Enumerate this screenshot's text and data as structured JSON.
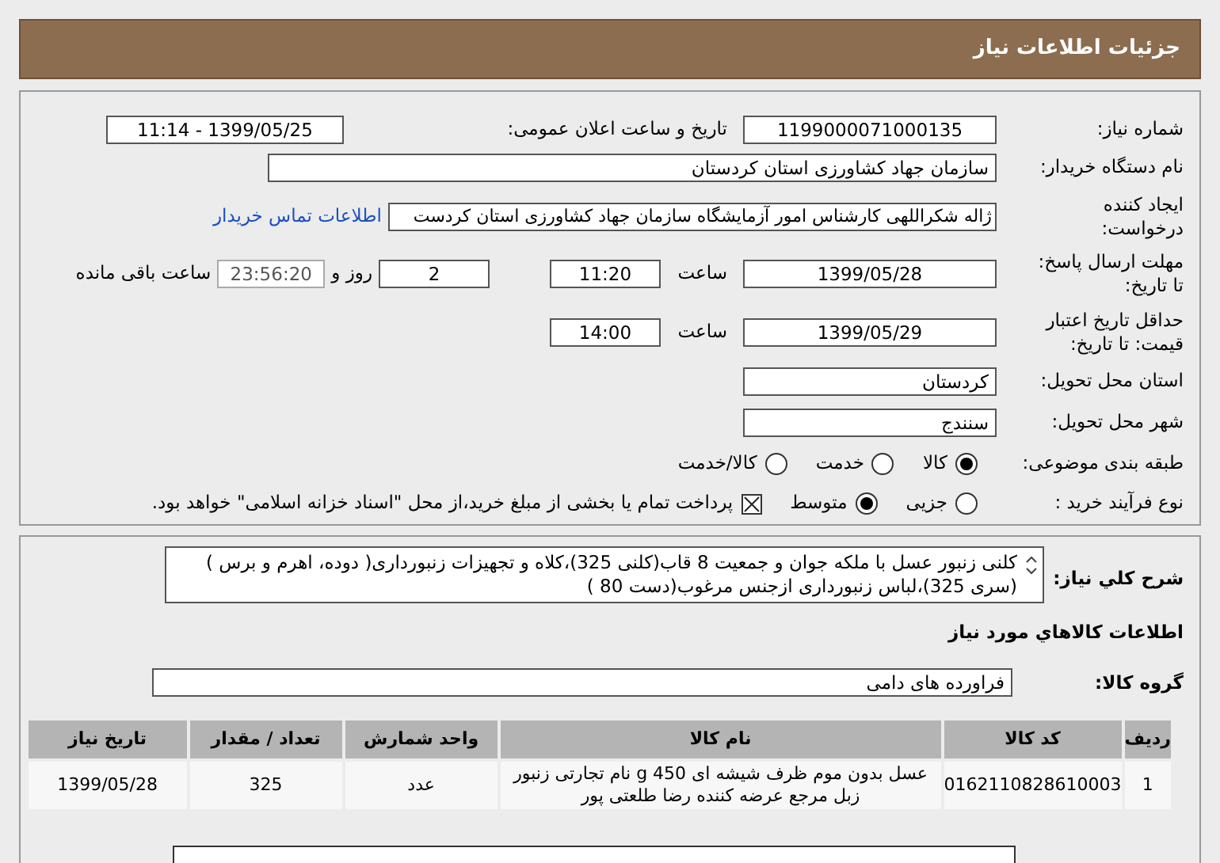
{
  "header": {
    "title": "جزئیات اطلاعات نیاز"
  },
  "need_number": {
    "label": "شماره نیاز:",
    "value": "1199000071000135"
  },
  "announce": {
    "label": "تاریخ و ساعت اعلان عمومی:",
    "value": "1399/05/25 - 11:14"
  },
  "buyer": {
    "label": "نام دستگاه خریدار:",
    "value": "سازمان جهاد کشاورزی استان کردستان"
  },
  "requester": {
    "label_lines": [
      "ایجاد کننده",
      "درخواست:"
    ],
    "value": "ژاله شکراللهی کارشناس امور آزمایشگاه سازمان جهاد کشاورزی استان کردست",
    "link": "اطلاعات تماس خریدار"
  },
  "deadline": {
    "label_lines": [
      "مهلت ارسال پاسخ:",
      "تا تاریخ:"
    ],
    "date": "1399/05/28",
    "time_label": "ساعت",
    "time": "11:20",
    "days": "2",
    "days_label": "روز و",
    "remaining": "23:56:20",
    "remaining_label": "ساعت باقی مانده"
  },
  "validity": {
    "label_lines": [
      "حداقل تاریخ اعتبار",
      "قیمت: تا تاریخ:"
    ],
    "date": "1399/05/29",
    "time_label": "ساعت",
    "time": "14:00"
  },
  "province": {
    "label": "استان محل تحویل:",
    "value": "کردستان"
  },
  "city": {
    "label": "شهر محل تحویل:",
    "value": "سنندج"
  },
  "category": {
    "label": "طبقه بندی موضوعی:",
    "options": [
      {
        "label": "کالا",
        "selected": true
      },
      {
        "label": "خدمت",
        "selected": false
      },
      {
        "label": "کالا/خدمت",
        "selected": false
      }
    ]
  },
  "process": {
    "label": "نوع فرآیند خرید :",
    "options": [
      {
        "label": "جزیی",
        "selected": false
      },
      {
        "label": "متوسط",
        "selected": true
      }
    ],
    "payment": {
      "checked": true,
      "text": "پرداخت تمام یا بخشی از مبلغ خرید،از محل \"اسناد خزانه اسلامی\" خواهد بود."
    }
  },
  "description": {
    "label": "شرح کلي نياز:",
    "value": "کلنی زنبور عسل با  ملکه جوان و جمعیت 8 قاب(کلنی 325)،کلاه و تجهیزات زنبورداری( دوده، اهرم و برس ) (سری 325)،لباس زنبورداری ازجنس مرغوب(دست 80 )"
  },
  "goods_section": {
    "title": "اطلاعات کالاهاي مورد نياز"
  },
  "goods_group": {
    "label": "گروه کالا:",
    "value": "فراورده های دامی"
  },
  "table": {
    "columns": [
      "ردیف",
      "کد کالا",
      "نام کالا",
      "واحد شمارش",
      "تعداد / مقدار",
      "تاریخ نیاز"
    ],
    "rows": [
      [
        "1",
        "0162110828610003",
        "عسل بدون موم ظرف شیشه ای 450 g نام تجارتی زنبور زبل مرجع عرضه کننده رضا طلعتی پور",
        "عدد",
        "325",
        "1399/05/28"
      ]
    ]
  }
}
